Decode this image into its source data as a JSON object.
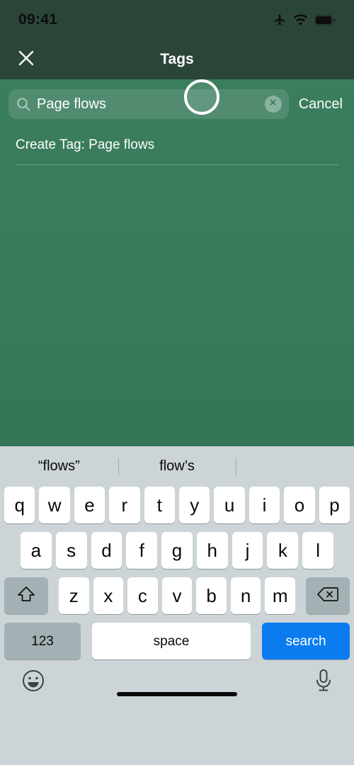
{
  "status_bar": {
    "time": "09:41",
    "icons": [
      "airplane-mode-icon",
      "wifi-icon",
      "battery-full-icon"
    ]
  },
  "nav_bar": {
    "title": "Tags",
    "close_icon": "close-icon"
  },
  "search": {
    "value": "Page flows",
    "placeholder": "Search",
    "search_icon": "search-icon",
    "clear_icon": "clear-circle-icon",
    "cancel_label": "Cancel"
  },
  "results": {
    "create_tag_label": "Create Tag: Page flows"
  },
  "keyboard": {
    "suggestions": [
      "“flows”",
      "flow’s",
      ""
    ],
    "row1": [
      "q",
      "w",
      "e",
      "r",
      "t",
      "y",
      "u",
      "i",
      "o",
      "p"
    ],
    "row2": [
      "a",
      "s",
      "d",
      "f",
      "g",
      "h",
      "j",
      "k",
      "l"
    ],
    "row3": [
      "z",
      "x",
      "c",
      "v",
      "b",
      "n",
      "m"
    ],
    "shift_icon": "shift-up-arrow-icon",
    "backspace_icon": "backspace-delete-icon",
    "numbers_label": "123",
    "space_label": "space",
    "return_label": "search",
    "emoji_icon": "emoji-smiley-icon",
    "dictation_icon": "microphone-icon"
  },
  "colors": {
    "nav_background": "#2c4539",
    "page_background_top": "#3b7f5f",
    "page_background_bottom": "#2f6a4f",
    "keyboard_background": "#ccd4d7",
    "key_white": "#ffffff",
    "key_gray": "#a3b1b4",
    "return_key_blue": "#0b7cf0",
    "text_on_green": "#ffffff"
  }
}
